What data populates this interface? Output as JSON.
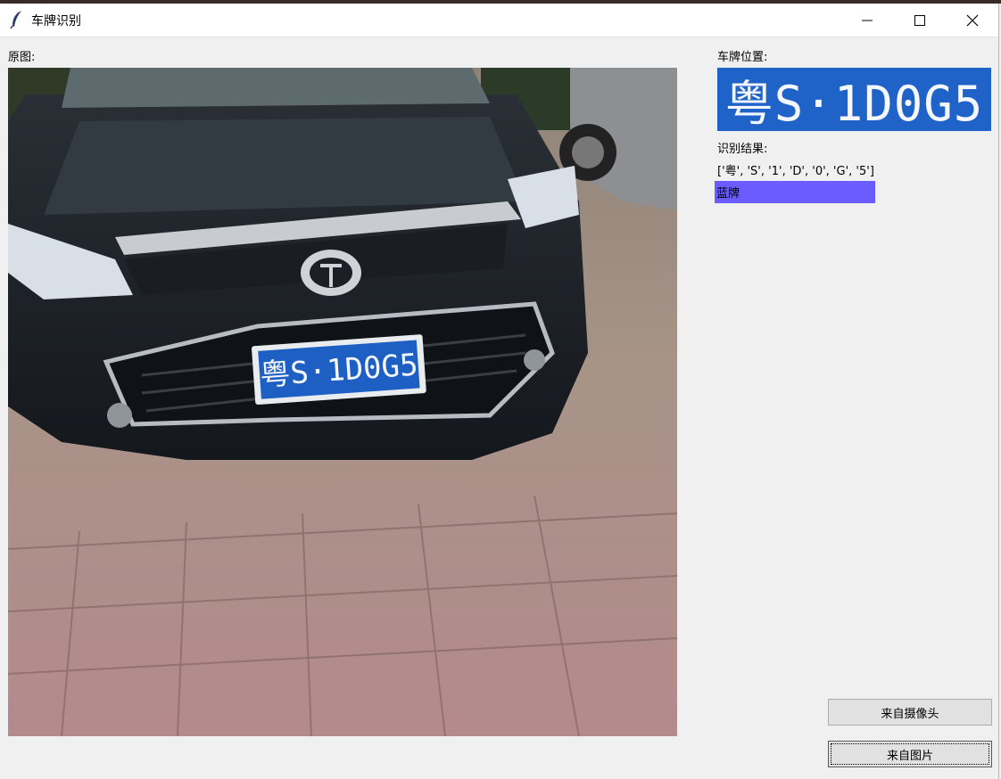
{
  "window": {
    "title": "车牌识别"
  },
  "labels": {
    "original": "原图:",
    "plate_position": "车牌位置:",
    "result_title": "识别结果:"
  },
  "plate": {
    "text": "粤S·1D0G5"
  },
  "result": {
    "chars": "['粤', 'S', '1', 'D', '0', 'G', '5']",
    "color": "蓝牌",
    "color_hex": "#6b5cff"
  },
  "buttons": {
    "camera": "来自摄像头",
    "picture": "来自图片"
  },
  "icons": {
    "app": "feather-icon",
    "minimize": "minimize-icon",
    "maximize": "maximize-icon",
    "close": "close-icon"
  }
}
